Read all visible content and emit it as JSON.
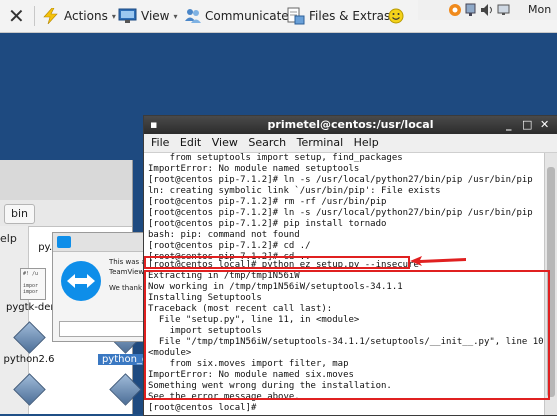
{
  "toolbar": {
    "actions": "Actions",
    "view": "View",
    "communicate": "Communicate",
    "files_extras": "Files & Extras",
    "caret": "▾",
    "close_glyph": "✕"
  },
  "remote_topbar": {
    "clock": "Mon"
  },
  "desktop": {
    "file_manager": {
      "path": "bin",
      "help_label": "elp",
      "files": [
        {
          "name": "py.sh"
        },
        {
          "name": "pygtk-demo"
        },
        {
          "name": "python2.6"
        },
        {
          "name": "python_o"
        }
      ],
      "doc_snippet": "#! /u\n\nimpor\nimpor"
    },
    "teamviewer_popup": {
      "line1": "This was a",
      "line2": "TeamViewe",
      "line3": "We thank"
    }
  },
  "terminal": {
    "title": "primetel@centos:/usr/local",
    "menu": [
      "File",
      "Edit",
      "View",
      "Search",
      "Terminal",
      "Help"
    ],
    "lines": [
      "    from setuptools import setup, find_packages",
      "ImportError: No module named setuptools",
      "[root@centos pip-7.1.2]# ln -s /usr/local/python27/bin/pip /usr/bin/pip",
      "ln: creating symbolic link `/usr/bin/pip': File exists",
      "[root@centos pip-7.1.2]# rm -rf /usr/bin/pip",
      "[root@centos pip-7.1.2]# ln -s /usr/local/python27/bin/pip /usr/bin/pip",
      "[root@centos pip-7.1.2]# pip install tornado",
      "bash: pip: command not found",
      "[root@centos pip-7.1.2]# cd ./",
      "[root@centos pip-7.1.2]# cd ..",
      "[root@centos local]# python ez setup.py --insecure",
      "Extracting in /tmp/tmp1N56iW",
      "Now working in /tmp/tmp1N56iW/setuptools-34.1.1",
      "Installing Setuptools",
      "Traceback (most recent call last):",
      "  File \"setup.py\", line 11, in <module>",
      "    import setuptools",
      "  File \"/tmp/tmp1N56iW/setuptools-34.1.1/setuptools/__init__.py\", line 10, in",
      "<module>",
      "    from six.moves import filter, map",
      "ImportError: No module named six.moves",
      "Something went wrong during the installation.",
      "See the error message above.",
      "[root@centos local]# "
    ]
  },
  "colors": {
    "annotation_red": "#e02020",
    "desktop_blue": "#1e4a80",
    "teamviewer_blue": "#0e8ee9"
  }
}
